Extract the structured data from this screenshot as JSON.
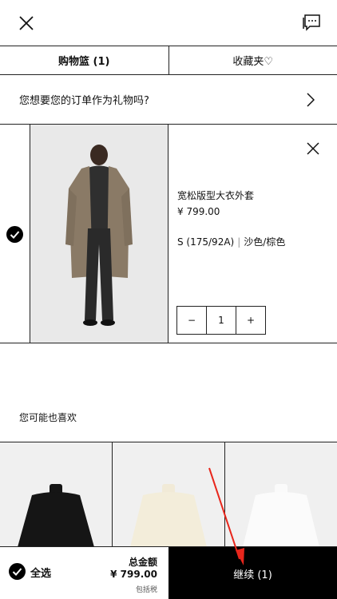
{
  "header": {
    "close_icon": "close-icon",
    "chat_icon": "chat-icon"
  },
  "tabs": [
    {
      "label": "购物篮 (1)",
      "active": true
    },
    {
      "label": "收藏夹♡",
      "active": false
    }
  ],
  "gift_prompt": "您想要您的订单作为礼物吗?",
  "cart_item": {
    "name": "宽松版型大衣外套",
    "price": "¥ 799.00",
    "size": "S (175/92A)",
    "separator": "|",
    "color": "沙色/棕色",
    "quantity": "1",
    "minus": "−",
    "plus": "+"
  },
  "recommendations": {
    "title": "您可能也喜欢"
  },
  "footer": {
    "select_all": "全选",
    "total_label": "总金额",
    "total_amount": "¥ 799.00",
    "tax_note": "包括税",
    "continue_label": "继续 (1)"
  },
  "colors": {
    "accent": "#000000",
    "annotation_arrow": "#e8261c"
  }
}
